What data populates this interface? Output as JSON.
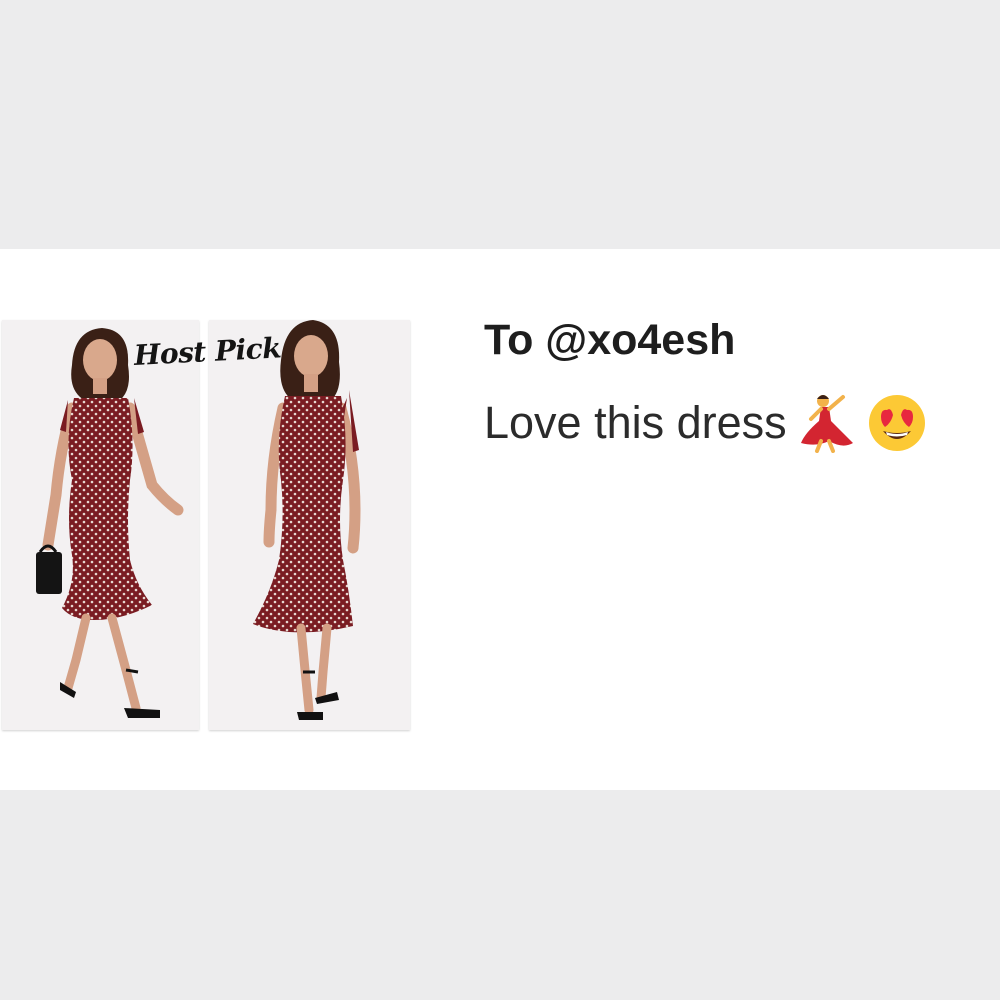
{
  "overlay": {
    "host_pick_label": "Host Pick"
  },
  "message": {
    "recipient": "To @xo4esh",
    "text": "Love this dress",
    "emojis": [
      "flamenco-dancer-icon",
      "heart-eyes-face-icon"
    ]
  },
  "products": [
    {
      "name": "polka-dot-dress-photo-walking"
    },
    {
      "name": "polka-dot-dress-photo-standing"
    }
  ],
  "colors": {
    "page_background": "#ececed",
    "card_background": "#ffffff",
    "dress": "#7a1c22",
    "dots": "#e8d8d2",
    "text": "#2b2b2b"
  }
}
